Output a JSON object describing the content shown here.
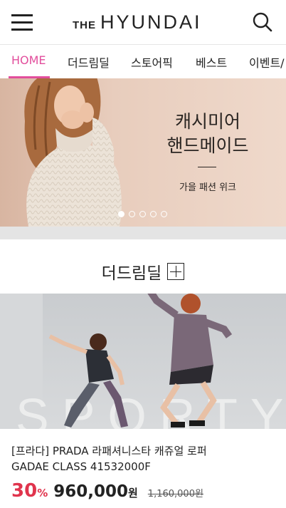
{
  "header": {
    "logo_prefix": "THE",
    "logo_brand": "HYUNDAI",
    "menu_icon": "hamburger-menu-icon",
    "search_icon": "search-icon"
  },
  "nav": {
    "items": [
      {
        "label": "HOME",
        "active": true
      },
      {
        "label": "더드림딜",
        "active": false
      },
      {
        "label": "스토어픽",
        "active": false
      },
      {
        "label": "베스트",
        "active": false
      },
      {
        "label": "이벤트/",
        "active": false
      }
    ],
    "active_color": "#e24e9c"
  },
  "banner": {
    "title_line1": "캐시미어",
    "title_line2": "핸드메이드",
    "subtitle": "가을 패션 위크",
    "slide_count": 5,
    "active_slide": 1
  },
  "section": {
    "title": "더드림딜",
    "expand_icon": "plus-box-icon"
  },
  "product": {
    "image_text": "SPORTY",
    "name_line1": "[프라다] PRADA 라패셔니스타 캐쥬얼 로퍼",
    "name_line2": "GADAE CLASS 41532000F",
    "discount": "30",
    "discount_symbol": "%",
    "price": "960,000",
    "price_unit": "원",
    "original_price": "1,160,000원",
    "discount_color": "#e0344d"
  }
}
